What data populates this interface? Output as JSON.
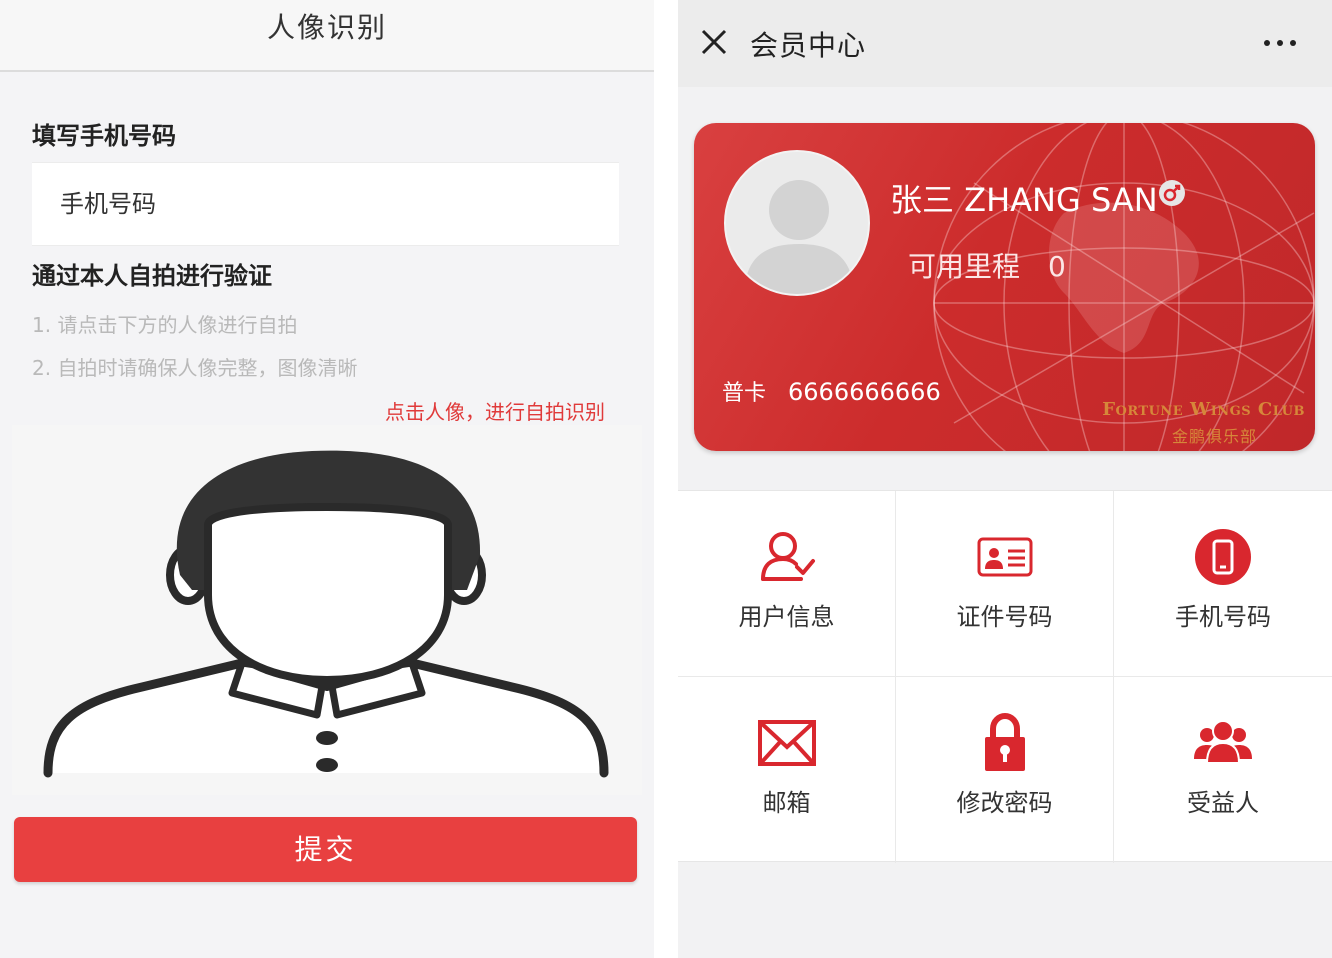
{
  "left": {
    "header_title": "人像识别",
    "phone_section_title": "填写手机号码",
    "phone_placeholder": "手机号码",
    "selfie_section_title": "通过本人自拍进行验证",
    "hints": [
      "1. 请点击下方的人像进行自拍",
      "2. 自拍时请确保人像完整，图像清晰"
    ],
    "tap_tip": "点击人像，进行自拍识别",
    "submit_label": "提交"
  },
  "right": {
    "header_title": "会员中心",
    "card": {
      "name": "张三 ZHANG SAN",
      "miles_label": "可用里程",
      "miles_value": "0",
      "level": "普卡",
      "card_number": "6666666666",
      "club_en": "Fortune Wings Club",
      "club_cn": "金鹏俱乐部"
    },
    "menu": [
      {
        "label": "用户信息",
        "icon": "user-check-icon"
      },
      {
        "label": "证件号码",
        "icon": "id-card-icon"
      },
      {
        "label": "手机号码",
        "icon": "mobile-phone-icon"
      },
      {
        "label": "邮箱",
        "icon": "envelope-icon"
      },
      {
        "label": "修改密码",
        "icon": "lock-icon"
      },
      {
        "label": "受益人",
        "icon": "group-icon"
      }
    ]
  },
  "colors": {
    "accent": "#e84040",
    "card": "#cc2c2c",
    "icon_red": "#d9272e",
    "gold": "#d6873a"
  }
}
